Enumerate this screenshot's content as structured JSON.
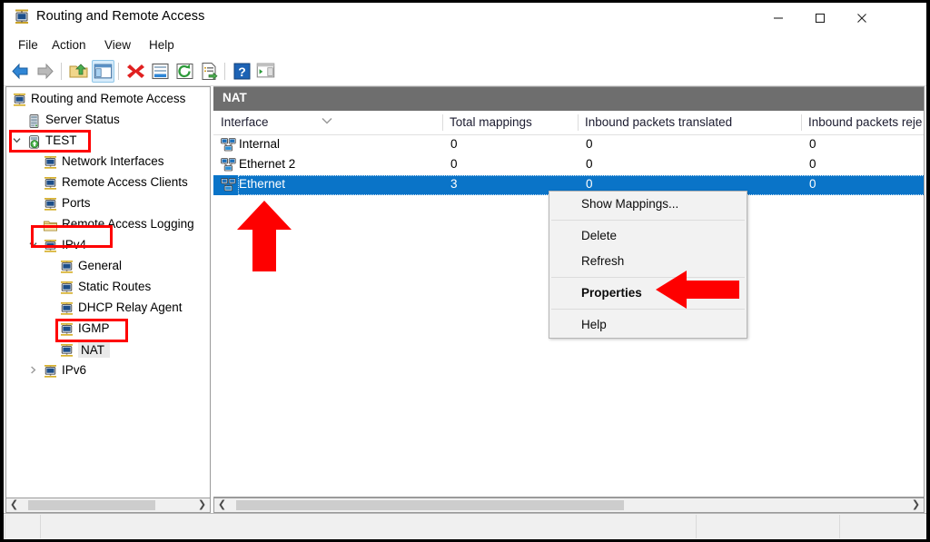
{
  "window": {
    "title": "Routing and Remote Access",
    "icon": "rras-server-icon",
    "controls": {
      "minimize": "Minimize",
      "maximize": "Maximize",
      "close": "Close"
    }
  },
  "menubar": {
    "items": [
      "File",
      "Action",
      "View",
      "Help"
    ]
  },
  "toolbar": {
    "buttons": [
      {
        "name": "back-icon",
        "tooltip": "Back"
      },
      {
        "name": "forward-icon",
        "tooltip": "Forward"
      },
      {
        "name": "up-one-level-icon",
        "tooltip": "Up One Level"
      },
      {
        "name": "show-hide-tree-icon",
        "tooltip": "Show/Hide Console Tree",
        "active": true
      },
      {
        "name": "delete-icon",
        "tooltip": "Delete"
      },
      {
        "name": "properties-icon",
        "tooltip": "Properties"
      },
      {
        "name": "refresh-icon",
        "tooltip": "Refresh"
      },
      {
        "name": "export-list-icon",
        "tooltip": "Export List"
      },
      {
        "name": "help-icon",
        "tooltip": "Help"
      },
      {
        "name": "show-hide-action-pane-icon",
        "tooltip": "Show/Hide Action Pane"
      }
    ]
  },
  "tree": {
    "nodes": [
      {
        "label": "Routing and Remote Access",
        "icon": "rras-root-icon",
        "indent": 0,
        "twisty": "",
        "selected": false
      },
      {
        "label": "Server Status",
        "icon": "server-status-icon",
        "indent": 1,
        "twisty": "",
        "selected": false
      },
      {
        "label": "TEST",
        "icon": "server-online-icon",
        "indent": 1,
        "twisty": "v",
        "selected": false
      },
      {
        "label": "Network Interfaces",
        "icon": "node-icon",
        "indent": 2,
        "twisty": "",
        "selected": false
      },
      {
        "label": "Remote Access Clients",
        "icon": "node-icon",
        "indent": 2,
        "twisty": "",
        "selected": false
      },
      {
        "label": "Ports",
        "icon": "node-icon",
        "indent": 2,
        "twisty": "",
        "selected": false
      },
      {
        "label": "Remote Access Logging",
        "icon": "folder-icon",
        "indent": 2,
        "twisty": "",
        "selected": false
      },
      {
        "label": "IPv4",
        "icon": "node-icon",
        "indent": 2,
        "twisty": "v",
        "selected": false
      },
      {
        "label": "General",
        "icon": "node-icon",
        "indent": 3,
        "twisty": "",
        "selected": false
      },
      {
        "label": "Static Routes",
        "icon": "node-icon",
        "indent": 3,
        "twisty": "",
        "selected": false
      },
      {
        "label": "DHCP Relay Agent",
        "icon": "node-icon",
        "indent": 3,
        "twisty": "",
        "selected": false
      },
      {
        "label": "IGMP",
        "icon": "node-icon",
        "indent": 3,
        "twisty": "",
        "selected": false
      },
      {
        "label": "NAT",
        "icon": "node-icon",
        "indent": 3,
        "twisty": "",
        "selected": true
      },
      {
        "label": "IPv6",
        "icon": "node-icon",
        "indent": 2,
        "twisty": ">",
        "selected": false
      }
    ]
  },
  "pane": {
    "header_title": "NAT"
  },
  "listview": {
    "columns": [
      {
        "label": "Interface",
        "sorted": true
      },
      {
        "label": "Total mappings",
        "sorted": false
      },
      {
        "label": "Inbound packets translated",
        "sorted": false
      },
      {
        "label": "Inbound packets reje",
        "sorted": false
      }
    ],
    "rows": [
      {
        "interface": "Internal",
        "total_mappings": "0",
        "inbound_translated": "0",
        "inbound_rejected": "0",
        "icon": "nat-interface-icon",
        "selected": false
      },
      {
        "interface": "Ethernet 2",
        "total_mappings": "0",
        "inbound_translated": "0",
        "inbound_rejected": "0",
        "icon": "nat-interface-icon",
        "selected": false
      },
      {
        "interface": "Ethernet",
        "total_mappings": "3",
        "inbound_translated": "0",
        "inbound_rejected": "0",
        "icon": "nat-interface-icon",
        "selected": true
      }
    ]
  },
  "context_menu": {
    "items": [
      {
        "label": "Show Mappings...",
        "bold": false,
        "separator_after": true
      },
      {
        "label": "Delete",
        "bold": false,
        "separator_after": false
      },
      {
        "label": "Refresh",
        "bold": false,
        "separator_after": true
      },
      {
        "label": "Properties",
        "bold": true,
        "separator_after": true
      },
      {
        "label": "Help",
        "bold": false,
        "separator_after": false
      }
    ]
  },
  "statusbar": {
    "cells": [
      "",
      "",
      ""
    ]
  },
  "annotations": {
    "highlight_color": "#fe0000",
    "boxes": [
      {
        "target": "tree-node-test"
      },
      {
        "target": "tree-node-ipv4"
      },
      {
        "target": "tree-node-nat"
      }
    ],
    "arrows": [
      {
        "target": "listview-row-ethernet",
        "direction": "up"
      },
      {
        "target": "context-menu-item-properties",
        "direction": "left"
      }
    ]
  },
  "colors": {
    "selection_blue": "#0a74c8",
    "pane_header_gray": "#6e6e6e",
    "annotation_red": "#fe0000"
  }
}
